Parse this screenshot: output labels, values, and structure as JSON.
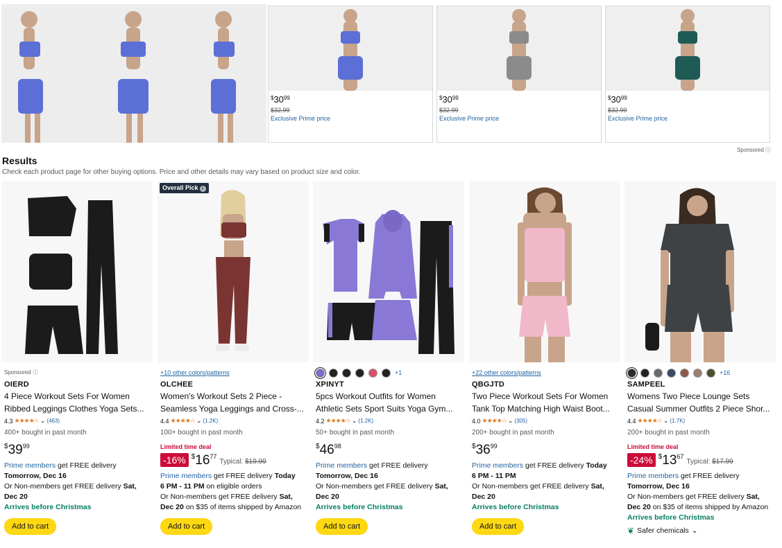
{
  "banner": {
    "cards": [
      {
        "price_symbol": "$",
        "price_whole": "30",
        "price_fraction": "99",
        "list_price": "$32.99",
        "prime_text": "Exclusive Prime price"
      },
      {
        "price_symbol": "$",
        "price_whole": "30",
        "price_fraction": "99",
        "list_price": "$32.99",
        "prime_text": "Exclusive Prime price"
      },
      {
        "price_symbol": "$",
        "price_whole": "30",
        "price_fraction": "99",
        "list_price": "$32.99",
        "prime_text": "Exclusive Prime price"
      }
    ],
    "sponsored_label": "Sponsored ⓘ"
  },
  "results": {
    "heading": "Results",
    "subheading": "Check each product page for other buying options. Price and other details may vary based on product size and color."
  },
  "products": [
    {
      "sponsored_label": "Sponsored ⓘ",
      "brand": "OIERD",
      "title_line1": "4 Piece Workout Sets For Women",
      "title_line2": "Ribbed Leggings Clothes Yoga Sets...",
      "rating_value": "4.3",
      "stars": "★★★★☆",
      "rating_count": "(463)",
      "bought": "400+ bought in past month",
      "price_symbol": "$",
      "price_whole": "39",
      "price_fraction": "99",
      "prime_members": "Prime members",
      "prime_free": " get FREE delivery",
      "prime_date": "Tomorrow, Dec 16",
      "nonmembers": "Or Non-members get FREE delivery ",
      "nonmembers_date": "Sat, Dec 20",
      "christmas": "Arrives before Christmas",
      "cart_label": "Add to cart"
    },
    {
      "badge": "Overall Pick",
      "colors_link": "+10 other colors/patterns",
      "brand": "OLCHEE",
      "title_line1": "Women's Workout Sets 2 Piece -",
      "title_line2": "Seamless Yoga Leggings and Cross-...",
      "rating_value": "4.4",
      "stars": "★★★★☆",
      "rating_count": "(1.2K)",
      "bought": "100+ bought in past month",
      "limited": "Limited time deal",
      "discount": "-16%",
      "price_symbol": "$",
      "price_whole": "16",
      "price_fraction": "77",
      "typical_label": "Typical: ",
      "typical_price": "$19.99",
      "prime_members": "Prime members",
      "prime_free": " get FREE delivery ",
      "prime_date": "Today",
      "prime_window": "6 PM - 11 PM",
      "prime_window_suffix": " on eligible orders",
      "nonmembers": "Or Non-members get FREE delivery ",
      "nonmembers_date": "Sat, Dec 20",
      "nonmembers_suffix": " on $35 of items shipped by Amazon",
      "cart_label": "Add to cart"
    },
    {
      "more_colors": "+1",
      "brand": "XPINYT",
      "title_line1": "5pcs Workout Outfits for Women",
      "title_line2": "Athletic Sets Sport Suits Yoga Gym...",
      "rating_value": "4.2",
      "stars": "★★★★☆",
      "rating_count": "(1.2K)",
      "bought": "50+ bought in past month",
      "price_symbol": "$",
      "price_whole": "46",
      "price_fraction": "98",
      "prime_members": "Prime members",
      "prime_free": " get FREE delivery",
      "prime_date": "Tomorrow, Dec 16",
      "nonmembers": "Or Non-members get FREE delivery ",
      "nonmembers_date": "Sat, Dec 20",
      "christmas": "Arrives before Christmas",
      "cart_label": "Add to cart"
    },
    {
      "colors_link": "+22 other colors/patterns",
      "brand": "QBGJTD",
      "title_line1": "Two Piece Workout Sets For Women",
      "title_line2": "Tank Top Matching High Waist Boot...",
      "rating_value": "4.0",
      "stars": "★★★★☆",
      "rating_count": "(305)",
      "bought": "200+ bought in past month",
      "price_symbol": "$",
      "price_whole": "36",
      "price_fraction": "99",
      "prime_members": "Prime members",
      "prime_free": " get FREE delivery ",
      "prime_date": "Today",
      "prime_window": "6 PM - 11 PM",
      "nonmembers": "Or Non-members get FREE delivery ",
      "nonmembers_date": "Sat, Dec 20",
      "christmas": "Arrives before Christmas",
      "cart_label": "Add to cart"
    },
    {
      "more_colors": "+16",
      "brand": "SAMPEEL",
      "title_line1": "Womens Two Piece Lounge Sets",
      "title_line2": "Casual Summer Outfits 2 Piece Shor...",
      "rating_value": "4.4",
      "stars": "★★★★☆",
      "rating_count": "(1.7K)",
      "bought": "200+ bought in past month",
      "limited": "Limited time deal",
      "discount": "-24%",
      "price_symbol": "$",
      "price_whole": "13",
      "price_fraction": "67",
      "typical_label": "Typical: ",
      "typical_price": "$17.99",
      "prime_members": "Prime members",
      "prime_free": " get FREE delivery",
      "prime_date": "Tomorrow, Dec 16",
      "nonmembers": "Or Non-members get FREE delivery ",
      "nonmembers_date": "Sat, Dec 20",
      "nonmembers_suffix": " on $35 of items shipped by Amazon",
      "christmas": "Arrives before Christmas",
      "safer": "Safer chemicals",
      "safer_icon": "leaf-icon"
    }
  ],
  "colors": {
    "prime_link": "#2162a1",
    "deal_red": "#cc0c39",
    "christmas_green": "#067d62",
    "cart_yellow": "#ffd814",
    "star_orange": "#de7921"
  }
}
